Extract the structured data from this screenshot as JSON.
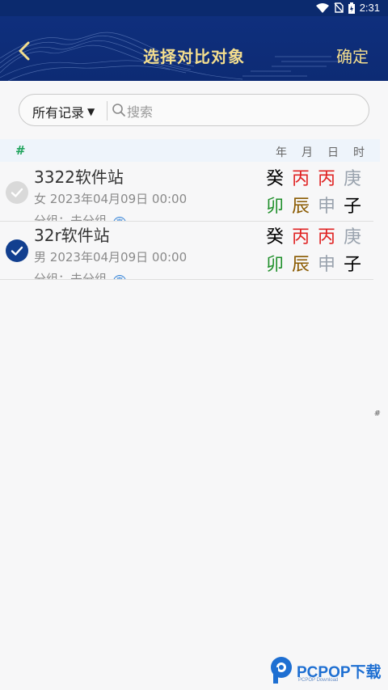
{
  "status_bar": {
    "time": "2:31"
  },
  "header": {
    "title": "选择对比对象",
    "confirm_label": "确定"
  },
  "search": {
    "filter_label": "所有记录",
    "placeholder": "搜索",
    "value": ""
  },
  "column_header": {
    "index_symbol": "#",
    "columns": [
      "年",
      "月",
      "日",
      "时"
    ]
  },
  "records": [
    {
      "name": "3322软件站",
      "gender": "女",
      "datetime": "2023年04月09日 00:00",
      "group": "分组：未分组",
      "tag": "真",
      "selected": false,
      "stems": [
        "癸",
        "丙",
        "丙",
        "庚"
      ],
      "branches": [
        "卯",
        "辰",
        "申",
        "子"
      ]
    },
    {
      "name": "32r软件站",
      "gender": "男",
      "datetime": "2023年04月09日 00:00",
      "group": "分组：未分组",
      "tag": "真",
      "selected": true,
      "stems": [
        "癸",
        "丙",
        "丙",
        "庚"
      ],
      "branches": [
        "卯",
        "辰",
        "申",
        "子"
      ]
    }
  ],
  "colors": {
    "header_bg": "#0f2f7d",
    "title_gold": "#f4de8e",
    "water": "#000000",
    "fire": "#e02424",
    "metal": "#9aa3ae",
    "wood": "#1f8f2a",
    "earth": "#8a5a00",
    "selected_check": "#123f8f"
  },
  "side_index": "#",
  "watermark": {
    "brand": "PCPOP下载",
    "sub": "PCPOP Download"
  }
}
